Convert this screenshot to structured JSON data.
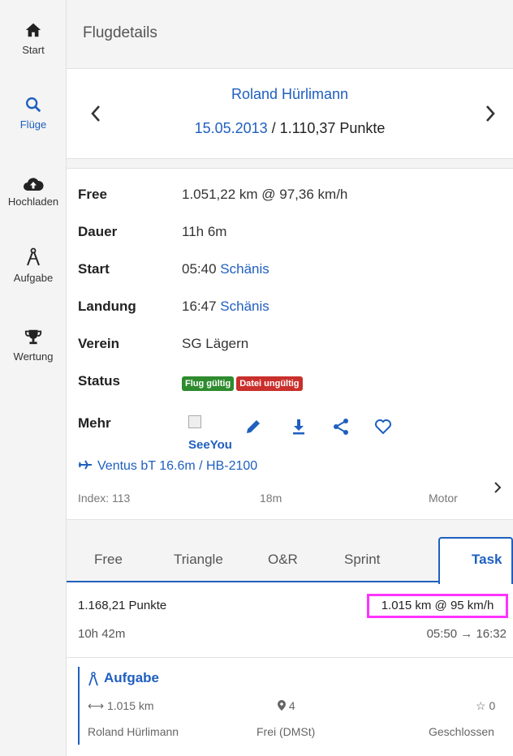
{
  "sidebar": {
    "items": [
      {
        "label": "Start",
        "icon": "home-icon"
      },
      {
        "label": "Flüge",
        "icon": "search-icon",
        "active": true
      },
      {
        "label": "Hochladen",
        "icon": "cloud-upload-icon"
      },
      {
        "label": "Aufgabe",
        "icon": "compass-icon"
      },
      {
        "label": "Wertung",
        "icon": "trophy-icon"
      }
    ]
  },
  "header": {
    "title": "Flugdetails"
  },
  "flight": {
    "pilot": "Roland Hürlimann",
    "date": "15.05.2013",
    "points_suffix": " / 1.110,37 Punkte"
  },
  "details": {
    "free_label": "Free",
    "free_value": "1.051,22 km @ 97,36 km/h",
    "dauer_label": "Dauer",
    "dauer_value": "11h 6m",
    "start_label": "Start",
    "start_time": "05:40",
    "start_place": "Schänis",
    "landung_label": "Landung",
    "landung_time": "16:47",
    "landung_place": "Schänis",
    "verein_label": "Verein",
    "verein_value": "SG Lägern",
    "status_label": "Status",
    "status_ok": "Flug gültig",
    "status_bad": "Datei ungültig",
    "mehr_label": "Mehr",
    "seeyou": "SeeYou"
  },
  "aircraft": {
    "name": "Ventus bT 16.6m / HB-2100",
    "index": "Index: 113",
    "span": "18m",
    "type": "Motor"
  },
  "tabs": [
    "Free",
    "Triangle",
    "O&R",
    "Sprint",
    "Task"
  ],
  "active_tab": "Task",
  "score": {
    "points": "1.168,21 Punkte",
    "speed": "1.015 km @ 95 km/h",
    "duration": "10h 42m",
    "time": "05:50 → 16:32"
  },
  "task": {
    "title": "Aufgabe",
    "distance": "1.015 km",
    "turnpoints": "4",
    "stars": "0",
    "pilot": "Roland Hürlimann",
    "category": "Frei (DMSt)",
    "status": "Geschlossen"
  },
  "colors": {
    "accent": "#1f5fbf",
    "highlight": "#ff33ff",
    "ok": "#2e8b2e",
    "bad": "#c9302c"
  }
}
